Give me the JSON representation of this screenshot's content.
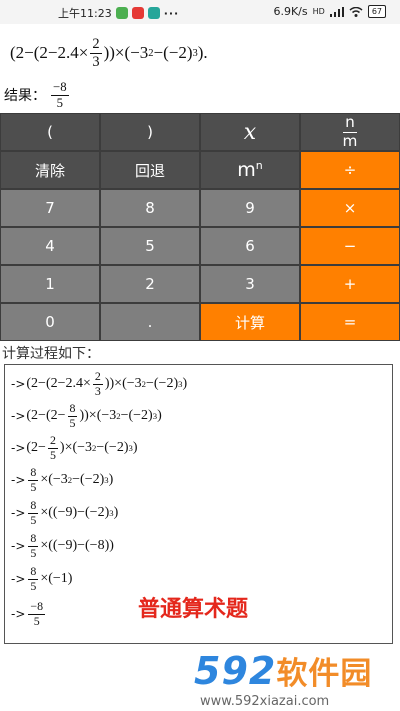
{
  "status": {
    "time": "上午11:23",
    "speed": "6.9K/s",
    "network": "HD",
    "battery": "67",
    "dots": "···"
  },
  "display": {
    "expr_open": "(2−(2−2.4×",
    "expr_frac_num": "2",
    "expr_frac_den": "3",
    "expr_close_1": "))×(−3",
    "expr_sup_1": "2",
    "expr_close_2": "−(−2)",
    "expr_sup_2": "3",
    "expr_close_3": ").",
    "result_label": "结果：",
    "result_num": "−8",
    "result_den": "5"
  },
  "keypad": {
    "row1": [
      "(",
      ")",
      "𝑥",
      "n/m"
    ],
    "frac_num": "n",
    "frac_den": "m",
    "clear": "清除",
    "back": "回退",
    "power_base": "m",
    "power_exp": "n",
    "divide": "÷",
    "k7": "7",
    "k8": "8",
    "k9": "9",
    "multiply": "×",
    "k4": "4",
    "k5": "5",
    "k6": "6",
    "minus": "−",
    "k1": "1",
    "k2": "2",
    "k3": "3",
    "plus": "+",
    "k0": "0",
    "dot": ".",
    "compute": "计算",
    "equals": "=",
    "x_label": "x"
  },
  "process": {
    "title": "计算过程如下：",
    "arrow": "->",
    "s1_a": "(2−(2−2.4×",
    "s1_fn": "2",
    "s1_fd": "3",
    "s1_b": "))×(−3",
    "s1_sup1": "2",
    "s1_c": "−(−2)",
    "s1_sup2": "3",
    "s1_d": ")",
    "s2_a": "(2−(2−",
    "s2_fn": "8",
    "s2_fd": "5",
    "s2_b": "))×(−3",
    "s2_sup1": "2",
    "s2_c": "−(−2)",
    "s2_sup2": "3",
    "s2_d": ")",
    "s3_a": "(2−",
    "s3_fn": "2",
    "s3_fd": "5",
    "s3_b": ")×(−3",
    "s3_sup1": "2",
    "s3_c": "−(−2)",
    "s3_sup2": "3",
    "s3_d": ")",
    "s4_fn": "8",
    "s4_fd": "5",
    "s4_b": "×(−3",
    "s4_sup1": "2",
    "s4_c": "−(−2)",
    "s4_sup2": "3",
    "s4_d": ")",
    "s5_fn": "8",
    "s5_fd": "5",
    "s5_b": "×((−9)−(−2)",
    "s5_sup": "3",
    "s5_d": ")",
    "s6_fn": "8",
    "s6_fd": "5",
    "s6_b": "×((−9)−(−8))",
    "s7_fn": "8",
    "s7_fd": "5",
    "s7_b": "×(−1)",
    "s8_fn": "−8",
    "s8_fd": "5",
    "banner": "普通算术题"
  },
  "watermark": {
    "digits": "592",
    "brand": "软件园",
    "url": "www.592xiazai.com"
  }
}
